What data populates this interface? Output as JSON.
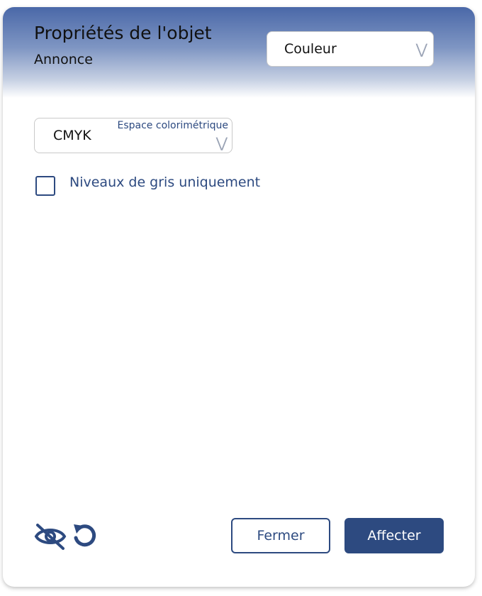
{
  "header": {
    "title": "Propriétés de l'objet",
    "subtitle": "Annonce"
  },
  "section_select": {
    "value": "Couleur",
    "icon": "chevron-down-icon"
  },
  "color_space": {
    "label": "Espace colorimétrique",
    "value": "CMYK",
    "icon": "chevron-down-icon"
  },
  "grayscale_option": {
    "label": "Niveaux de gris uniquement",
    "checked": false
  },
  "footer": {
    "visibility_icon": "eye-slash-icon",
    "reset_icon": "undo-icon",
    "close_label": "Fermer",
    "apply_label": "Affecter"
  },
  "colors": {
    "accent": "#2d4a80",
    "header_top": "#4a68a8"
  }
}
